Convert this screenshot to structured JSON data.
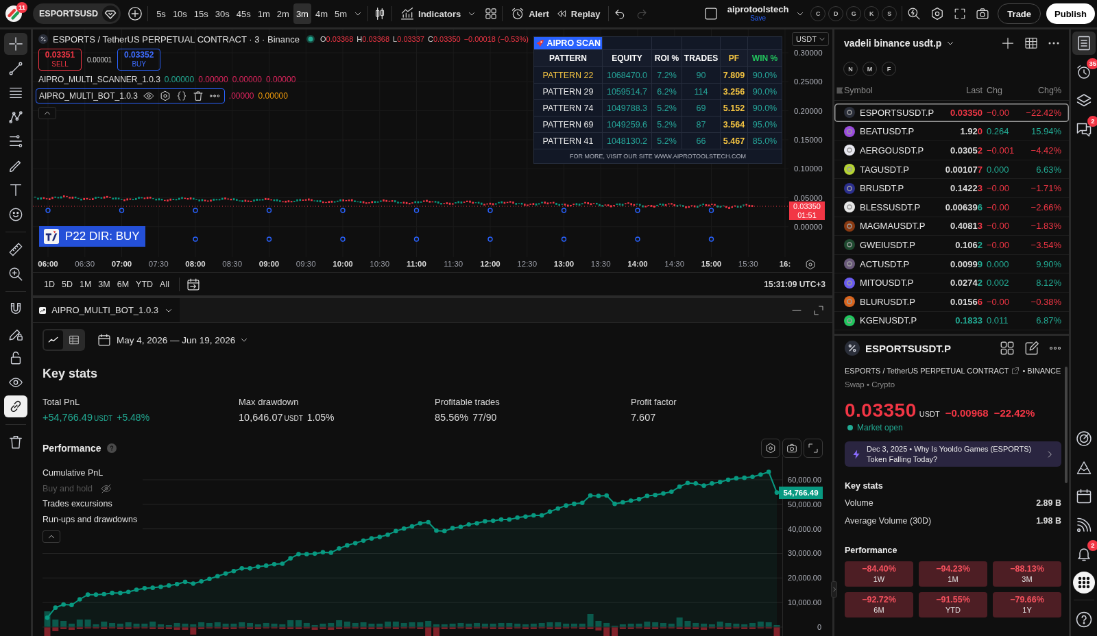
{
  "top_bar": {
    "notifications_badge": "11",
    "symbol": "ESPORTSUSD",
    "intervals": [
      {
        "label": "5s",
        "selected": false
      },
      {
        "label": "10s",
        "selected": false
      },
      {
        "label": "15s",
        "selected": false
      },
      {
        "label": "30s",
        "selected": false
      },
      {
        "label": "45s",
        "selected": false
      },
      {
        "label": "1m",
        "selected": false
      },
      {
        "label": "2m",
        "selected": false
      },
      {
        "label": "3m",
        "selected": true
      },
      {
        "label": "4m",
        "selected": false
      },
      {
        "label": "5m",
        "selected": false
      }
    ],
    "indicators_label": "Indicators",
    "alert_label": "Alert",
    "replay_label": "Replay",
    "undo_disabled": false,
    "redo_disabled": true,
    "layout_name": "aiprotoolstech",
    "layout_status": "Save",
    "letter_buttons": [
      "C",
      "D",
      "G",
      "K",
      "S"
    ],
    "trade_label": "Trade",
    "publish_label": "Publish"
  },
  "left_toolbar": {
    "groups": [
      {
        "tools": [
          {
            "kind": "crosshair",
            "selected": true
          },
          {
            "kind": "trendline",
            "selected": false
          },
          {
            "kind": "fibonacci",
            "selected": false
          },
          {
            "kind": "pattern",
            "selected": false
          },
          {
            "kind": "projection",
            "selected": false
          },
          {
            "kind": "brush",
            "selected": false
          },
          {
            "kind": "text",
            "selected": false
          },
          {
            "kind": "emoji",
            "selected": false
          }
        ]
      },
      {
        "tools": [
          {
            "kind": "ruler",
            "selected": false
          },
          {
            "kind": "zoom",
            "selected": false
          }
        ]
      },
      {
        "tools": [
          {
            "kind": "magnet",
            "on": false
          },
          {
            "kind": "drawlock",
            "on": false
          },
          {
            "kind": "lock",
            "on": false
          },
          {
            "kind": "eye",
            "on": false
          },
          {
            "kind": "link",
            "on": true
          }
        ]
      },
      {
        "tools": [
          {
            "kind": "trash"
          }
        ]
      }
    ]
  },
  "chart": {
    "title": "ESPORTS / TetherUS PERPETUAL CONTRACT · 3 · Binance",
    "candle_falling": true,
    "ohlc": [
      {
        "key": "O",
        "value": "0.03368"
      },
      {
        "key": "H",
        "value": "0.03368"
      },
      {
        "key": "L",
        "value": "0.03337"
      },
      {
        "key": "C",
        "value": "0.03350"
      }
    ],
    "change": "−0.00018 (−0.53%)",
    "sell": {
      "price": "0.03351",
      "label": "SELL"
    },
    "spread": "0.00001",
    "buy": {
      "price": "0.03352",
      "label": "BUY"
    },
    "indicators": [
      {
        "name": "AIPRO_MULTI_SCANNER_1.0.3",
        "selected": false,
        "values": [
          {
            "text": "0.00000",
            "color": "#22ab94"
          },
          {
            "text": "0.00000",
            "color": "#e0245e"
          },
          {
            "text": "0.00000",
            "color": "#e0245e"
          },
          {
            "text": "0.00000",
            "color": "#e0245e"
          }
        ]
      },
      {
        "name": "AIPRO_MULTI_BOT_1.0.3",
        "selected": true,
        "values": [
          {
            "text": ".00000",
            "color": "#e0245e"
          },
          {
            "text": "0.00000",
            "color": "#f59e0b"
          }
        ]
      }
    ],
    "scan_table": {
      "title": "AIPRO SCAN",
      "columns": [
        {
          "label": "PATTERN",
          "color": "#ffffff"
        },
        {
          "label": "EQUITY",
          "color": "#ffffff"
        },
        {
          "label": "ROI %",
          "color": "#ffffff"
        },
        {
          "label": "TRADES",
          "color": "#ffffff"
        },
        {
          "label": "PF",
          "color": "#f5c542"
        },
        {
          "label": "WIN %",
          "color": "#22c55e"
        }
      ],
      "rows": [
        {
          "cells": [
            "PATTERN 22",
            "1068470.0",
            "7.2%",
            "90",
            "7.809",
            "90.0%"
          ],
          "highlighted": true
        },
        {
          "cells": [
            "PATTERN 29",
            "1059514.7",
            "6.2%",
            "114",
            "3.256",
            "90.0%"
          ],
          "highlighted": false
        },
        {
          "cells": [
            "PATTERN 74",
            "1049788.3",
            "5.2%",
            "69",
            "5.152",
            "90.0%"
          ],
          "highlighted": false
        },
        {
          "cells": [
            "PATTERN 69",
            "1049259.6",
            "5.2%",
            "87",
            "3.564",
            "95.0%"
          ],
          "highlighted": false
        },
        {
          "cells": [
            "PATTERN 41",
            "1048130.2",
            "5.2%",
            "66",
            "5.467",
            "85.0%"
          ],
          "highlighted": false
        }
      ],
      "footer": "FOR MORE, VISIT OUR SITE WWW.AIPROTOOLSTECH.COM"
    },
    "currency": "USDT",
    "price_ticks": [
      "0.30000",
      "0.25000",
      "0.20000",
      "0.15000",
      "0.10000",
      "0.05000",
      "0.00000"
    ],
    "last_price": "0.03350",
    "countdown": "01:51",
    "signal_label": "P22 DIR: BUY",
    "time_ticks": [
      {
        "label": "06:00",
        "major": true
      },
      {
        "label": "06:30",
        "major": false
      },
      {
        "label": "07:00",
        "major": true
      },
      {
        "label": "07:30",
        "major": false
      },
      {
        "label": "08:00",
        "major": true
      },
      {
        "label": "08:30",
        "major": false
      },
      {
        "label": "09:00",
        "major": true
      },
      {
        "label": "09:30",
        "major": false
      },
      {
        "label": "10:00",
        "major": true
      },
      {
        "label": "10:30",
        "major": false
      },
      {
        "label": "11:00",
        "major": true
      },
      {
        "label": "11:30",
        "major": false
      },
      {
        "label": "12:00",
        "major": true
      },
      {
        "label": "12:30",
        "major": false
      },
      {
        "label": "13:00",
        "major": true
      },
      {
        "label": "13:30",
        "major": false
      },
      {
        "label": "14:00",
        "major": true
      },
      {
        "label": "14:30",
        "major": false
      },
      {
        "label": "15:00",
        "major": true
      },
      {
        "label": "15:30",
        "major": false
      },
      {
        "label": "16:",
        "major": true
      }
    ],
    "ranges": [
      "1D",
      "5D",
      "1M",
      "3M",
      "6M",
      "YTD",
      "All"
    ],
    "clock": "15:31:09 UTC+3"
  },
  "strategy": {
    "tab": "AIPRO_MULTI_BOT_1.0.3",
    "views": [
      {
        "kind": "chart",
        "selected": true
      },
      {
        "kind": "table",
        "selected": false
      }
    ],
    "date_range": "May 4, 2026 — Jun 19, 2026",
    "key_stats_title": "Key stats",
    "stats": [
      {
        "label": "Total PnL",
        "value": "+54,766.49",
        "unit": "USDT",
        "extra": "+5.48%",
        "positive": true
      },
      {
        "label": "Max drawdown",
        "value": "10,646.07",
        "unit": "USDT",
        "extra": "1.05%",
        "positive": false
      },
      {
        "label": "Profitable trades",
        "value": "85.56%",
        "extra": "77/90",
        "positive": false
      },
      {
        "label": "Profit factor",
        "value": "7.607",
        "positive": false
      }
    ],
    "performance_title": "Performance",
    "legend": [
      {
        "label": "Buy and hold",
        "hidden": true
      },
      {
        "label": "Trades excursions",
        "hidden": false
      },
      {
        "label": "Run-ups and drawdowns",
        "hidden": false
      }
    ],
    "last_value_label": "54,766.49",
    "performance_chart": {
      "chart_data": {
        "type": "area",
        "grid": true,
        "ylim": [
          -4200,
          69500
        ],
        "yticks": [
          {
            "value": 0,
            "label": "0"
          },
          {
            "value": 10000,
            "label": "10,000.00"
          },
          {
            "value": 20000,
            "label": "20,000.00"
          },
          {
            "value": 30000,
            "label": "30,000.00"
          },
          {
            "value": 40000,
            "label": "40,000.00"
          },
          {
            "value": 50000,
            "label": "50,000.00"
          },
          {
            "value": 60000,
            "label": "60,000.00"
          }
        ],
        "series": [
          {
            "name": "Cumulative PnL",
            "color": "#089981",
            "marker": "o",
            "values": [
              3800,
              7900,
              9200,
              9000,
              11300,
              13200,
              13200,
              13400,
              13900,
              13900,
              14300,
              15200,
              15800,
              16000,
              16400,
              16900,
              17500,
              18400,
              17700,
              18600,
              19600,
              20700,
              21800,
              22800,
              23900,
              23900,
              24600,
              25000,
              25600,
              25800,
              28000,
              29700,
              29700,
              29900,
              30500,
              30300,
              32000,
              33300,
              34200,
              35200,
              36100,
              36700,
              37600,
              39100,
              40100,
              41000,
              42300,
              42700,
              39300,
              39100,
              40300,
              40800,
              41800,
              42300,
              43100,
              43300,
              43800,
              43800,
              44600,
              45000,
              45500,
              45500,
              47000,
              48300,
              49500,
              50200,
              50600,
              53600,
              53400,
              53600,
              50200,
              50800,
              51500,
              52100,
              53400,
              53800,
              54400,
              55100,
              57200,
              58700,
              58500,
              57600,
              58500,
              59100,
              60000,
              60600,
              60800,
              61200,
              62100,
              63200,
              54800
            ]
          }
        ]
      }
    }
  },
  "watchlist": {
    "name": "vadeli binance usdt.p",
    "filters": [
      "N",
      "M",
      "F"
    ],
    "columns": [
      "Symbol",
      "Last",
      "Chg",
      "Chg%"
    ],
    "rows": [
      {
        "symbol": "ESPORTSUSDT.P",
        "color": "#2a2e39",
        "last": [
          {
            "text": "0.03350",
            "color": "#f23645"
          }
        ],
        "change": "−0.00",
        "change_pct": "−22.42%",
        "falling": true,
        "selected": true
      },
      {
        "symbol": "BEATUSDT.P",
        "color": "#9b4dde",
        "last": [
          {
            "text": "1.92",
            "color": "#dbdbdb"
          },
          {
            "text": "0",
            "color": "#f23645"
          }
        ],
        "change": "0.264",
        "change_pct": "15.94%",
        "falling": false,
        "selected": false
      },
      {
        "symbol": "AERGOUSDT.P",
        "color": "#e8e8f0",
        "last": [
          {
            "text": "0.0305",
            "color": "#dbdbdb"
          },
          {
            "text": "2",
            "color": "#f23645"
          }
        ],
        "change": "−0.001",
        "change_pct": "−4.42%",
        "falling": true,
        "selected": false
      },
      {
        "symbol": "TAGUSDT.P",
        "color": "#b5d334",
        "last": [
          {
            "text": "0.00107",
            "color": "#dbdbdb"
          },
          {
            "text": "7",
            "color": "#f23645"
          }
        ],
        "change": "0.000",
        "change_pct": "6.63%",
        "falling": false,
        "selected": false
      },
      {
        "symbol": "BRUSDT.P",
        "color": "#2b2f8f",
        "last": [
          {
            "text": "0.1422",
            "color": "#dbdbdb"
          },
          {
            "text": "3",
            "color": "#f23645"
          }
        ],
        "change": "−0.00",
        "change_pct": "−1.71%",
        "falling": true,
        "selected": false
      },
      {
        "symbol": "BLESSUSDT.P",
        "color": "#e6e6e6",
        "last": [
          {
            "text": "0.00639",
            "color": "#dbdbdb"
          },
          {
            "text": "6",
            "color": "#22ab94"
          }
        ],
        "change": "−0.00",
        "change_pct": "−2.66%",
        "falling": true,
        "selected": false
      },
      {
        "symbol": "MAGMAUSDT.P",
        "color": "#8a3a12",
        "last": [
          {
            "text": "0.4081",
            "color": "#dbdbdb"
          },
          {
            "text": "3",
            "color": "#f23645"
          }
        ],
        "change": "−0.00",
        "change_pct": "−1.83%",
        "falling": true,
        "selected": false
      },
      {
        "symbol": "GWEIUSDT.P",
        "color": "#1f4a30",
        "last": [
          {
            "text": "0.106",
            "color": "#dbdbdb"
          },
          {
            "text": "2",
            "color": "#22ab94"
          }
        ],
        "change": "−0.00",
        "change_pct": "−3.54%",
        "falling": true,
        "selected": false
      },
      {
        "symbol": "ACTUSDT.P",
        "color": "#6a5a7a",
        "last": [
          {
            "text": "0.0099",
            "color": "#dbdbdb"
          },
          {
            "text": "9",
            "color": "#22ab94"
          }
        ],
        "change": "0.000",
        "change_pct": "9.90%",
        "falling": false,
        "selected": false
      },
      {
        "symbol": "MITOUSDT.P",
        "color": "#6a5cf0",
        "last": [
          {
            "text": "0.0274",
            "color": "#dbdbdb"
          },
          {
            "text": "2",
            "color": "#22ab94"
          }
        ],
        "change": "0.002",
        "change_pct": "8.12%",
        "falling": false,
        "selected": false
      },
      {
        "symbol": "BLURUSDT.P",
        "color": "#d9661f",
        "last": [
          {
            "text": "0.0156",
            "color": "#dbdbdb"
          },
          {
            "text": "6",
            "color": "#f23645"
          }
        ],
        "change": "−0.00",
        "change_pct": "−0.38%",
        "falling": true,
        "selected": false
      },
      {
        "symbol": "KGENUSDT.P",
        "color": "#22c55e",
        "last": [
          {
            "text": "0.1833",
            "color": "#22ab94"
          }
        ],
        "change": "0.011",
        "change_pct": "6.87%",
        "falling": false,
        "selected": false
      }
    ]
  },
  "details": {
    "symbol": "ESPORTSUSDT.P",
    "description": "ESPORTS / TetherUS PERPETUAL CONTRACT",
    "exchange": "• BINANCE",
    "category": "Swap • Crypto",
    "price": "0.03350",
    "currency": "USDT",
    "change": "−0.00968",
    "change_pct": "−22.42%",
    "falling": true,
    "market": {
      "label": "Market open",
      "open": true
    },
    "news": "Dec 3, 2025 • Why Is Yooldo Games (ESPORTS) Token Falling Today?",
    "key_stats_title": "Key stats",
    "stats": [
      {
        "label": "Volume",
        "value": "2.89 B"
      },
      {
        "label": "Average Volume (30D)",
        "value": "1.98 B"
      }
    ],
    "performance_title": "Performance",
    "performance": [
      {
        "value": "−84.40%",
        "period": "1W",
        "falling": true
      },
      {
        "value": "−94.23%",
        "period": "1M",
        "falling": true
      },
      {
        "value": "−88.13%",
        "period": "3M",
        "falling": true
      },
      {
        "value": "−92.72%",
        "period": "6M",
        "falling": true
      },
      {
        "value": "−91.55%",
        "period": "YTD",
        "falling": true
      },
      {
        "value": "−79.66%",
        "period": "1Y",
        "falling": true
      }
    ]
  },
  "right_bar": {
    "groups": [
      {
        "tools": [
          {
            "kind": "watchlist",
            "selected": true
          },
          {
            "kind": "alarm",
            "selected": false,
            "badge": "35"
          },
          {
            "kind": "layers",
            "selected": false
          },
          {
            "kind": "chat",
            "selected": false,
            "badge": "2"
          }
        ]
      },
      {
        "tools": [
          {
            "kind": "target",
            "selected": false
          },
          {
            "kind": "ideas",
            "selected": false
          },
          {
            "kind": "calendar",
            "selected": false
          },
          {
            "kind": "signal",
            "selected": false
          },
          {
            "kind": "bell",
            "selected": false,
            "badge": "2"
          },
          {
            "kind": "apps",
            "selected": false
          }
        ]
      },
      {
        "tools": [
          {
            "kind": "help",
            "selected": false
          }
        ]
      }
    ]
  }
}
